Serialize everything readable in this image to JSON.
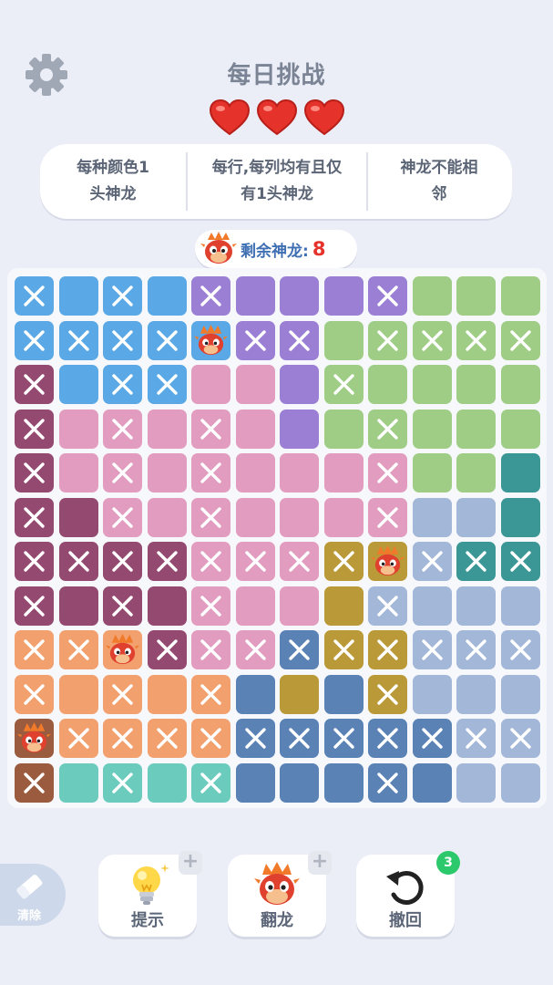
{
  "header": {
    "title": "每日挑战",
    "settings_icon": "gear-icon",
    "lives": 3
  },
  "rules": [
    {
      "line1": "每种颜色1",
      "line2": "头神龙"
    },
    {
      "line1": "每行,每列均有且仅",
      "line2": "有1头神龙"
    },
    {
      "line1": "神龙不能相",
      "line2": "邻"
    }
  ],
  "remaining": {
    "label": "剩余神龙:",
    "count": "8"
  },
  "board": {
    "size": 12,
    "palette": {
      "a": "#5aa9e6",
      "b": "#9a7fd5",
      "c": "#9fcd86",
      "d": "#944a70",
      "e": "#e19cbf",
      "f": "#3b9696",
      "g": "#a3b7d8",
      "h": "#ba9a38",
      "i": "#f2a06e",
      "j": "#5a82b5",
      "k": "#9a5b3f",
      "l": "#6bcbbd"
    },
    "regions": [
      "aaaabbbbbccc",
      "aaaaabbccccc",
      "daaaeebccccc",
      "deeeeebccccc",
      "deeeeeeeeccf",
      "ddeeeeeeeggf",
      "ddddeeehhgff",
      "ddddeeehgggg",
      "iiideejhhggg",
      "iiiiijhjhggg",
      "kiiiijjjjjgg",
      "klllljjjjjgg"
    ],
    "marks": [
      "x.x.x...x...",
      "xxxx.xx.xxxx",
      "x.xx...x....",
      "x.x.x...x...",
      "x.x.x...x...",
      "x.x.x...x...",
      "xxxxxxxx.xxx",
      "x.x.x...x...",
      "xx.xxxxxxxxx",
      "x.x.x...x...",
      ".xxxxxxxxxxx",
      "x.x.x...x..."
    ],
    "dragons": [
      {
        "row": 1,
        "col": 4
      },
      {
        "row": 6,
        "col": 8
      },
      {
        "row": 8,
        "col": 2
      },
      {
        "row": 10,
        "col": 0
      }
    ]
  },
  "toolbar": {
    "eraser_label": "清除",
    "hint_label": "提示",
    "flip_label": "翻龙",
    "undo_label": "撤回",
    "undo_count": "3",
    "plus": "+"
  }
}
